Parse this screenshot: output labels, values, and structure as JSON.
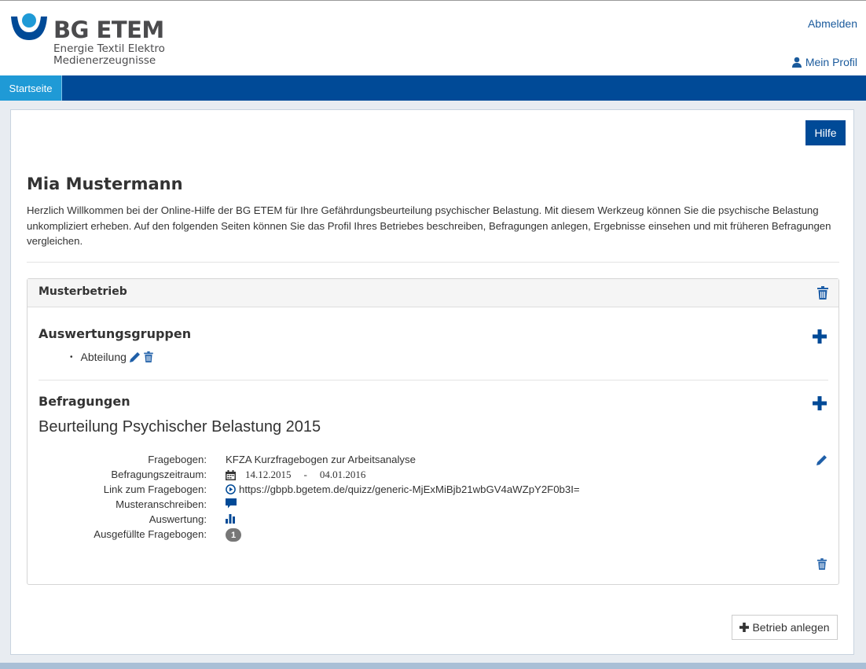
{
  "header": {
    "brand": "BG ETEM",
    "subtitle_line1": "Energie Textil Elektro",
    "subtitle_line2": "Medienerzeugnisse",
    "logout": "Abmelden",
    "profile": "Mein Profil"
  },
  "nav": {
    "tabs": [
      {
        "label": "Startseite",
        "active": true
      }
    ]
  },
  "main": {
    "help_button": "Hilfe",
    "user_name": "Mia Mustermann",
    "intro": "Herzlich Willkommen bei der Online-Hilfe der BG ETEM für Ihre Gefährdungsbeurteilung psychischer Belastung. Mit diesem Werkzeug können Sie die psychische Belastung unkompliziert erheben. Auf den folgenden Seiten können Sie das Profil Ihres Betriebes beschreiben, Befragungen anlegen, Ergebnisse einsehen und mit früheren Befragungen vergleichen.",
    "add_company_button": "Betrieb anlegen"
  },
  "company": {
    "name": "Musterbetrieb",
    "groups_title": "Auswertungsgruppen",
    "groups": [
      {
        "label": "Abteilung"
      }
    ],
    "surveys_title": "Befragungen",
    "survey": {
      "title": "Beurteilung Psychischer Belastung 2015",
      "labels": {
        "questionnaire": "Fragebogen:",
        "period": "Befragungszeitraum:",
        "link": "Link zum Fragebogen:",
        "letter": "Musteranschreiben:",
        "evaluation": "Auswertung:",
        "completed": "Ausgefüllte Fragebogen:"
      },
      "questionnaire": "KFZA Kurzfragebogen zur Arbeitsanalyse",
      "period_start": "14.12.2015",
      "period_sep": "-",
      "period_end": "04.01.2016",
      "link": "https://gbpb.bgetem.de/quizz/generic-MjExMiBjb21wbGV4aWZpY2F0b3I=",
      "completed_count": "1"
    }
  },
  "colors": {
    "primary": "#004a97",
    "nav_active": "#1f9ad6",
    "link": "#1a5a9c",
    "icon": "#1f5fa8"
  }
}
